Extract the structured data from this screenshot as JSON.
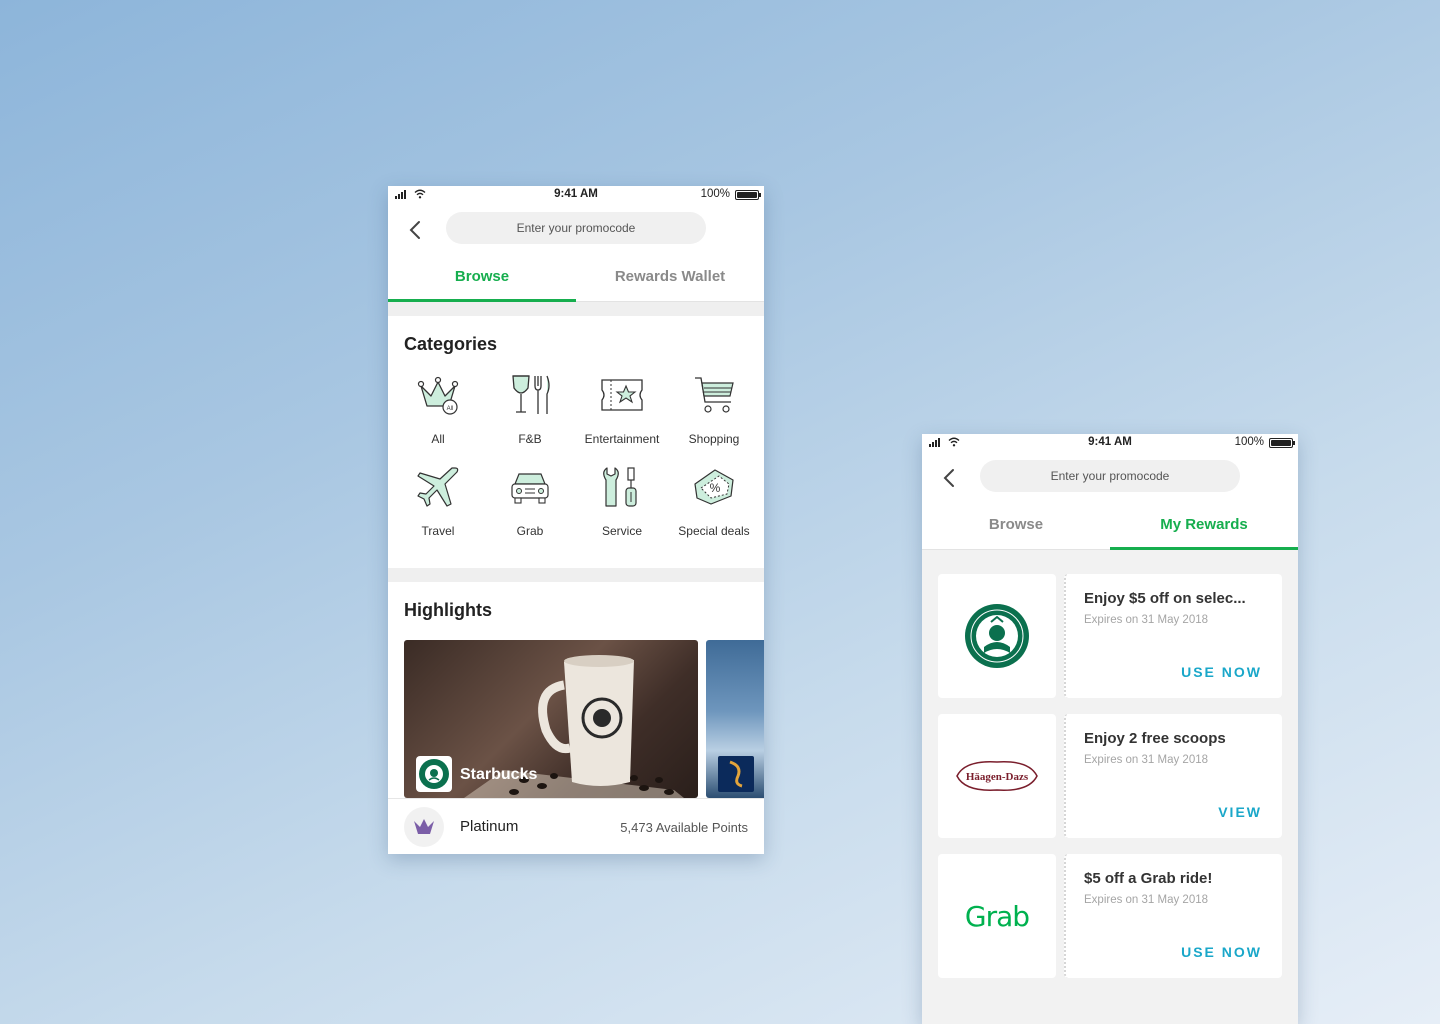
{
  "phone_browse": {
    "status": {
      "time": "9:41 AM",
      "battery": "100%"
    },
    "promo": {
      "placeholder": "Enter your promocode"
    },
    "tabs": [
      {
        "label": "Browse",
        "active": true
      },
      {
        "label": "Rewards Wallet",
        "active": false
      }
    ],
    "categories_title": "Categories",
    "categories": [
      {
        "label": "All",
        "icon": "crown-all-icon"
      },
      {
        "label": "F&B",
        "icon": "wine-cutlery-icon"
      },
      {
        "label": "Entertainment",
        "icon": "ticket-icon"
      },
      {
        "label": "Shopping",
        "icon": "shopping-cart-icon"
      },
      {
        "label": "Travel",
        "icon": "airplane-icon"
      },
      {
        "label": "Grab",
        "icon": "car-icon"
      },
      {
        "label": "Service",
        "icon": "tools-icon"
      },
      {
        "label": "Special deals",
        "icon": "discount-tag-icon"
      }
    ],
    "highlights_title": "Highlights",
    "highlights": [
      {
        "brand": "Starbucks",
        "logo": "starbucks-logo"
      },
      {
        "brand": "",
        "logo": "singapore-airlines-logo"
      }
    ],
    "tier": {
      "name": "Platinum",
      "points": "5,473 Available Points",
      "icon": "crown-icon"
    }
  },
  "phone_rewards": {
    "status": {
      "time": "9:41 AM",
      "battery": "100%"
    },
    "promo": {
      "placeholder": "Enter your promocode"
    },
    "tabs": [
      {
        "label": "Browse",
        "active": false
      },
      {
        "label": "My Rewards",
        "active": true
      }
    ],
    "rewards": [
      {
        "brand_logo": "starbucks-logo",
        "title": "Enjoy $5 off on selec...",
        "expires": "Expires on 31 May 2018",
        "action": "USE NOW"
      },
      {
        "brand_logo": "haagen-dazs-logo",
        "brand_text": "Häagen-Dazs",
        "title": "Enjoy 2 free scoops",
        "expires": "Expires on 31 May 2018",
        "action": "VIEW"
      },
      {
        "brand_logo": "grab-logo",
        "brand_text": "Grab",
        "title": "$5 off a Grab ride!",
        "expires": "Expires on 31 May 2018",
        "action": "USE NOW"
      }
    ]
  },
  "colors": {
    "accent": "#16ae4e",
    "action": "#1aa7c9",
    "tier": "#7b5ea7"
  }
}
